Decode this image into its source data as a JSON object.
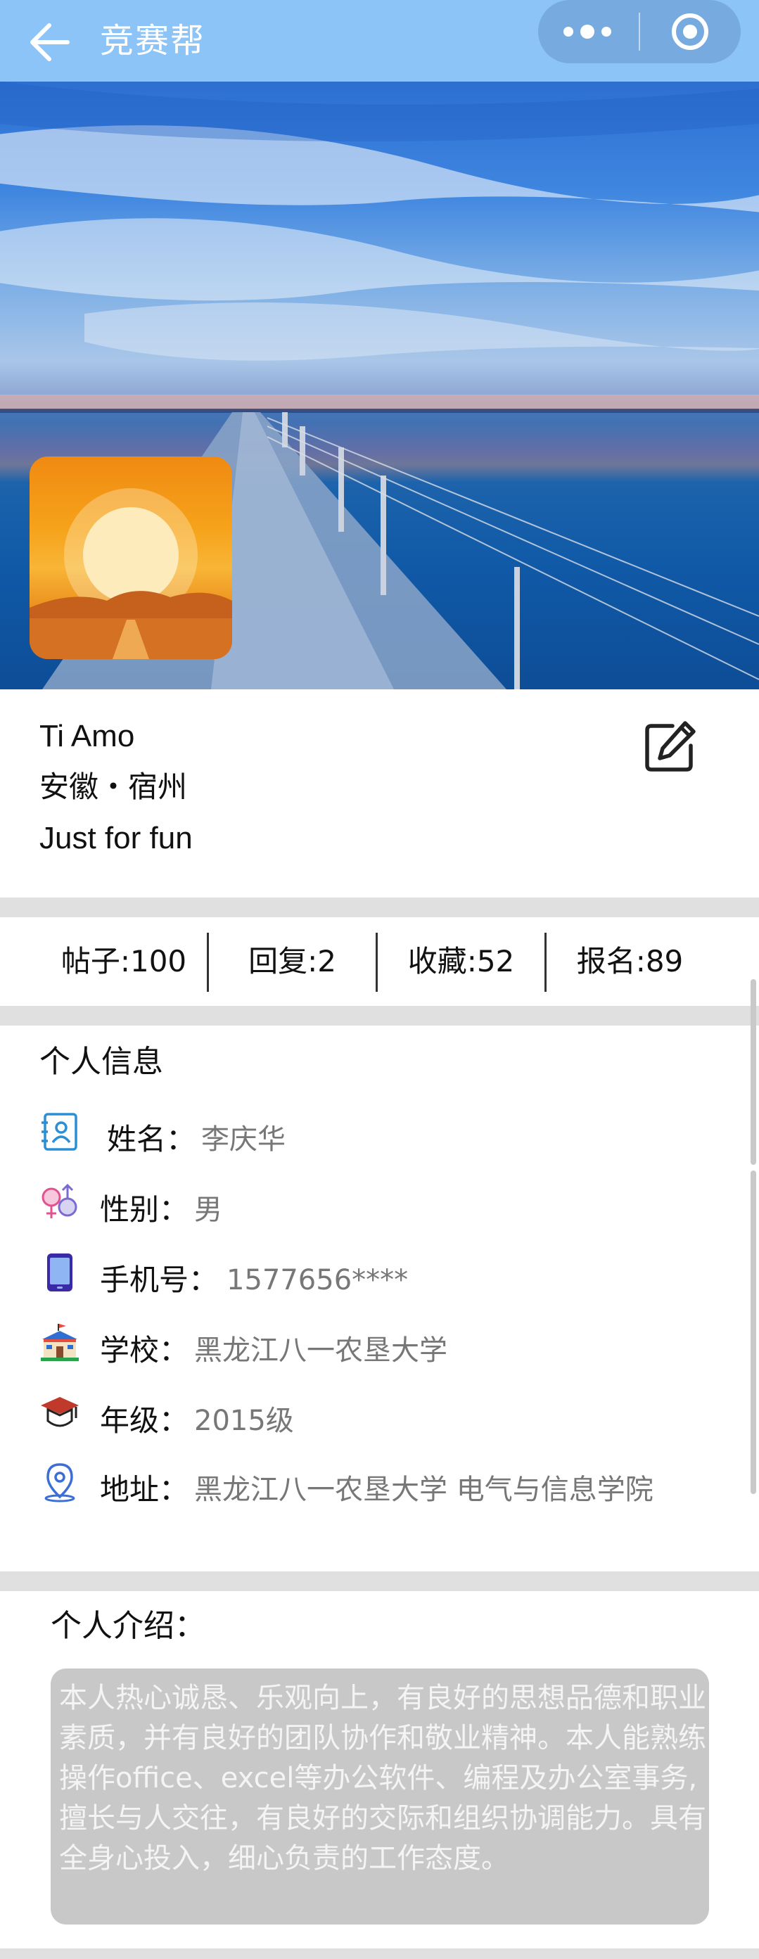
{
  "navbar": {
    "title": "竞赛帮",
    "bg_color": "#8cc4f7",
    "back_icon": "back-arrow-icon",
    "more_icon": "more-dots-icon",
    "close_icon": "target-circle-icon"
  },
  "profile": {
    "name": "Ti Amo",
    "location": "安徽・宿州",
    "bio": "Just for fun",
    "edit_icon": "edit-icon"
  },
  "stats": [
    {
      "label": "帖子:100"
    },
    {
      "label": "回复:2"
    },
    {
      "label": "收藏:52"
    },
    {
      "label": "报名:89"
    }
  ],
  "personal_info": {
    "title": "个人信息",
    "rows": [
      {
        "icon": "contact-card-icon",
        "label": "姓名：",
        "value": "李庆华"
      },
      {
        "icon": "gender-icon",
        "label": "性别：",
        "value": "男"
      },
      {
        "icon": "phone-icon",
        "label": "手机号：",
        "value": "1577656****"
      },
      {
        "icon": "school-icon",
        "label": "学校：",
        "value": "黑龙江八一农垦大学"
      },
      {
        "icon": "graduation-cap-icon",
        "label": "年级：",
        "value": "2015级"
      },
      {
        "icon": "location-pin-icon",
        "label": "地址：",
        "value": "黑龙江八一农垦大学 电气与信息学院"
      }
    ]
  },
  "intro": {
    "title": "个人介绍：",
    "text": "本人热心诚恳、乐观向上，有良好的思想品德和职业素质，并有良好的团队协作和敬业精神。本人能熟练操作office、excel等办公软件、编程及办公室事务,擅长与人交往，有良好的交际和组织协调能力。具有全身心投入，细心负责的工作态度。"
  }
}
